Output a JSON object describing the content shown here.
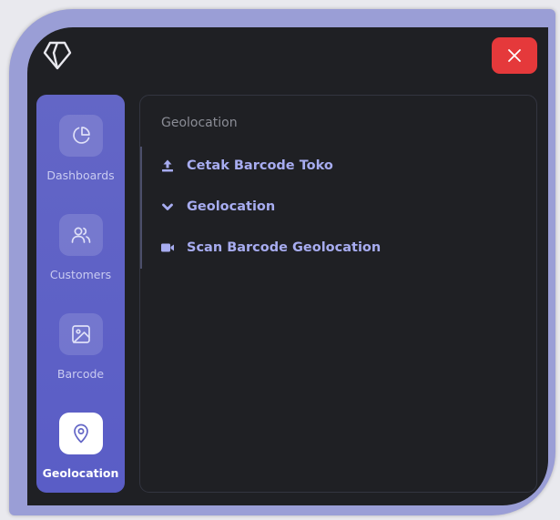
{
  "colors": {
    "frame": "#9a9ed6",
    "window_bg": "#1f2024",
    "sidebar_bg": "#5f62c6",
    "close_bg": "#e5393b",
    "menu_text": "#a7acf0",
    "muted_text": "#8b8d96"
  },
  "header": {
    "logo_icon": "diamond-logo-icon",
    "close_icon": "close-icon"
  },
  "sidebar": {
    "items": [
      {
        "label": "Dashboards",
        "icon": "pie-chart-icon",
        "active": false
      },
      {
        "label": "Customers",
        "icon": "users-icon",
        "active": false
      },
      {
        "label": "Barcode",
        "icon": "image-icon",
        "active": false
      },
      {
        "label": "Geolocation",
        "icon": "map-pin-icon",
        "active": true
      }
    ]
  },
  "panel": {
    "title": "Geolocation",
    "items": [
      {
        "label": "Cetak Barcode Toko",
        "icon": "upload-icon"
      },
      {
        "label": "Geolocation",
        "icon": "chevron-down-icon"
      },
      {
        "label": "Scan Barcode Geolocation",
        "icon": "video-camera-icon"
      }
    ]
  }
}
